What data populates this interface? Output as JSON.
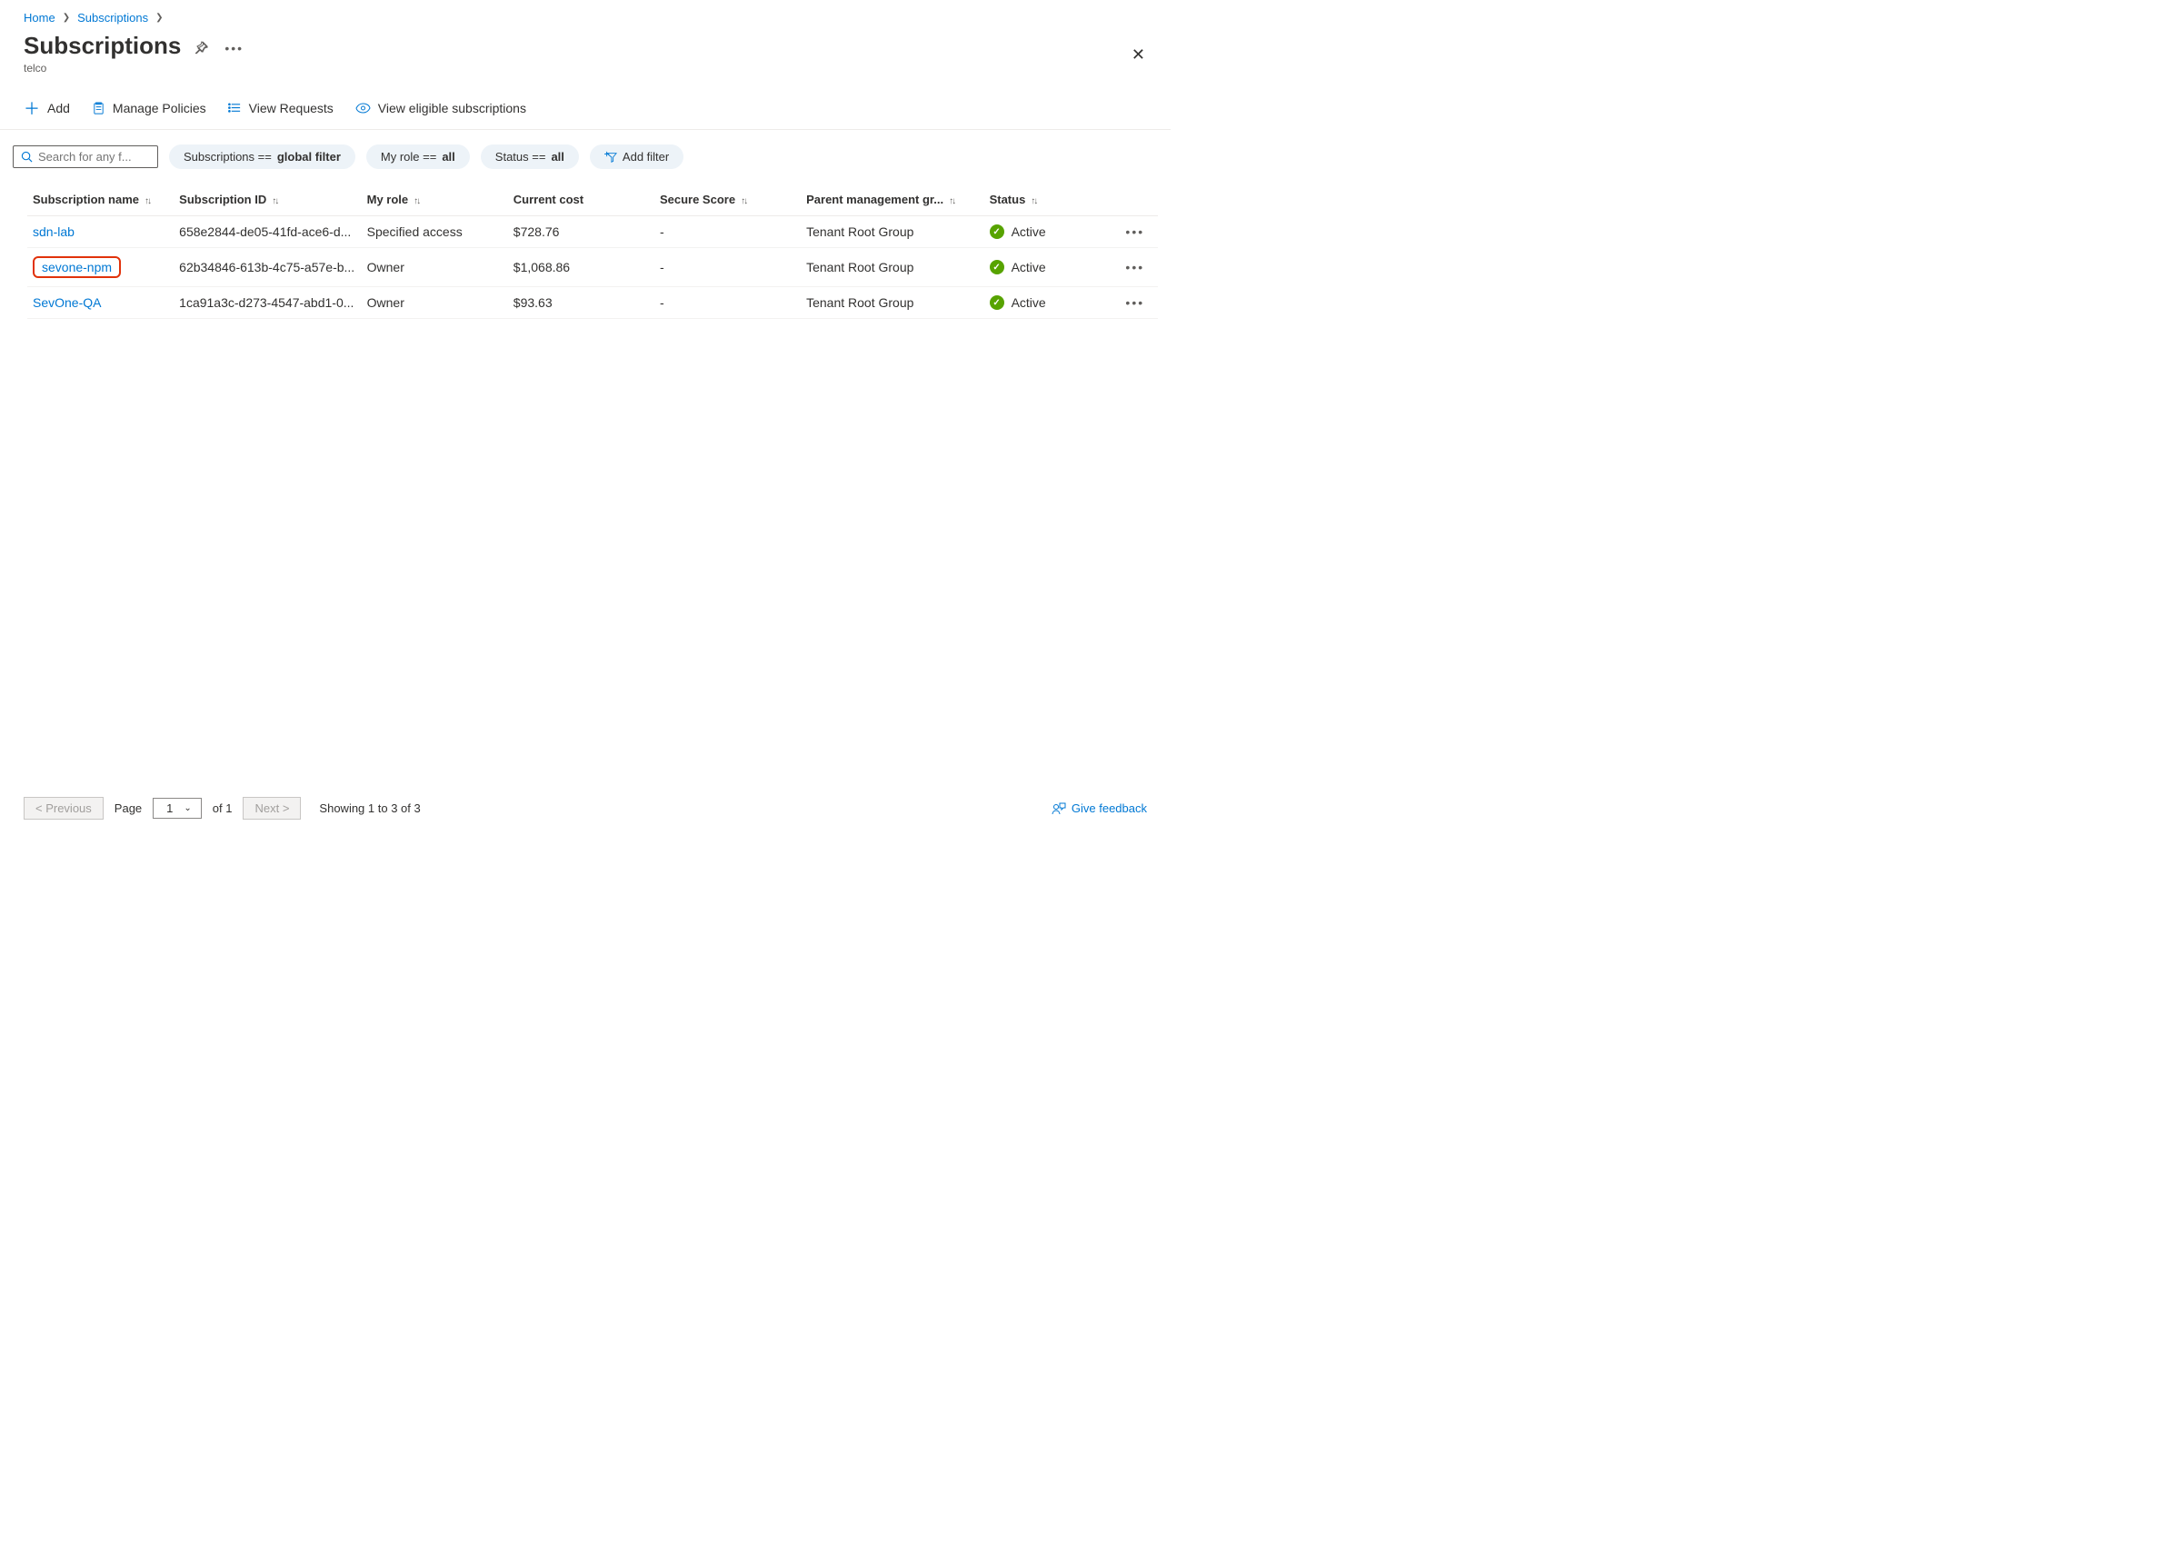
{
  "breadcrumb": {
    "home": "Home",
    "subs": "Subscriptions"
  },
  "title": "Subscriptions",
  "subtitle": "telco",
  "commands": {
    "add": "Add",
    "policies": "Manage Policies",
    "requests": "View Requests",
    "eligible": "View eligible subscriptions"
  },
  "search": {
    "placeholder": "Search for any f..."
  },
  "filters": {
    "f1_pre": "Subscriptions == ",
    "f1_val": "global filter",
    "f2_pre": "My role == ",
    "f2_val": "all",
    "f3_pre": "Status == ",
    "f3_val": "all",
    "add": "Add filter"
  },
  "columns": {
    "name": "Subscription name",
    "id": "Subscription ID",
    "role": "My role",
    "cost": "Current cost",
    "score": "Secure Score",
    "parent": "Parent management gr...",
    "status": "Status"
  },
  "rows": [
    {
      "name": "sdn-lab",
      "id": "658e2844-de05-41fd-ace6-d...",
      "role": "Specified access",
      "cost": "$728.76",
      "score": "-",
      "parent": "Tenant Root Group",
      "status": "Active",
      "highlighted": false
    },
    {
      "name": "sevone-npm",
      "id": "62b34846-613b-4c75-a57e-b...",
      "role": "Owner",
      "cost": "$1,068.86",
      "score": "-",
      "parent": "Tenant Root Group",
      "status": "Active",
      "highlighted": true
    },
    {
      "name": "SevOne-QA",
      "id": "1ca91a3c-d273-4547-abd1-0...",
      "role": "Owner",
      "cost": "$93.63",
      "score": "-",
      "parent": "Tenant Root Group",
      "status": "Active",
      "highlighted": false
    }
  ],
  "pagination": {
    "prev": "<  Previous",
    "pageLabel": "Page",
    "pageNum": "1",
    "of": "of 1",
    "next": "Next  >",
    "showing": "Showing 1 to 3 of 3"
  },
  "feedback": "Give feedback"
}
